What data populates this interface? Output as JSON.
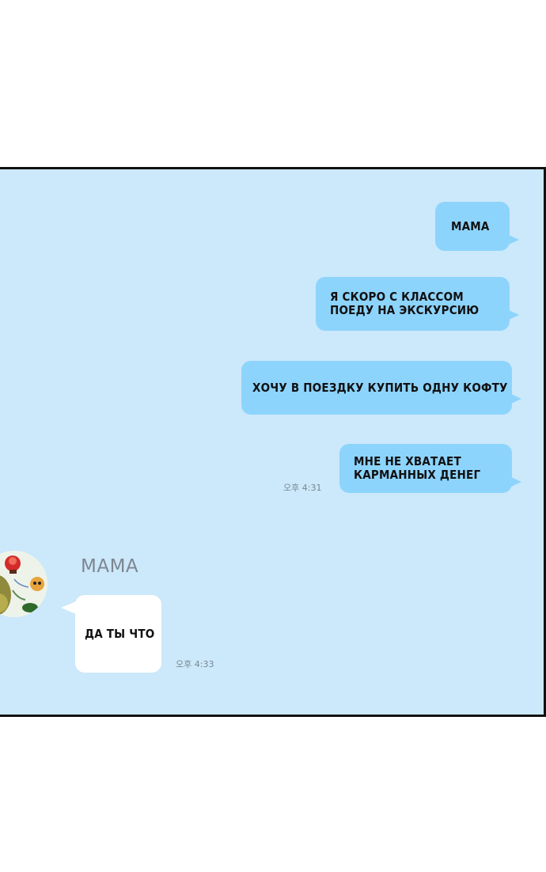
{
  "chat": {
    "outgoing": [
      {
        "text": "МАМА"
      },
      {
        "text": "Я СКОРО С КЛАССОМ\nПОЕДУ НА ЭКСКУРСИЮ"
      },
      {
        "text": "ХОЧУ В ПОЕЗДКУ КУПИТЬ ОДНУ КОФТУ"
      },
      {
        "text": "МНЕ НЕ ХВАТАЕТ\nКАРМАННЫХ ДЕНЕГ"
      }
    ],
    "outgoing_time": "오후 4:31",
    "incoming": {
      "sender": "МАМА",
      "text": "ДА ТЫ ЧТО",
      "time": "오후 4:33"
    }
  },
  "colors": {
    "chat_background": "#cce8fb",
    "outgoing_bubble": "#8dd4fd",
    "incoming_bubble": "#ffffff",
    "panel_border": "#111111"
  },
  "icons": {
    "avatar": "avatar-image"
  }
}
